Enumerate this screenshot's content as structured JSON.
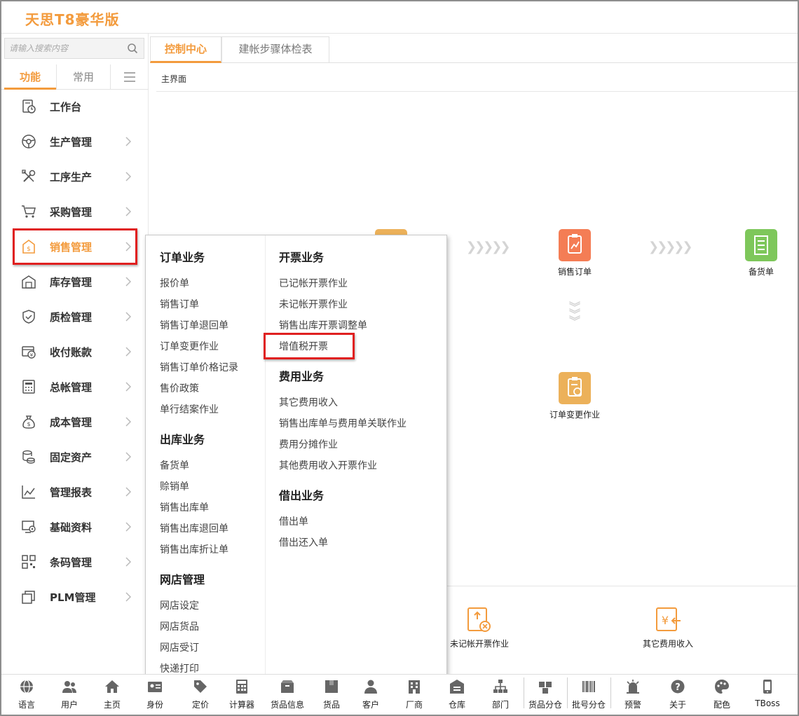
{
  "header": {
    "logo_text": "天思T8豪华版"
  },
  "search": {
    "placeholder": "请输入搜索内容"
  },
  "sidebar": {
    "tabs": [
      {
        "label": "功能"
      },
      {
        "label": "常用"
      }
    ],
    "items": [
      {
        "label": "工作台"
      },
      {
        "label": "生产管理"
      },
      {
        "label": "工序生产"
      },
      {
        "label": "采购管理"
      },
      {
        "label": "销售管理"
      },
      {
        "label": "库存管理"
      },
      {
        "label": "质检管理"
      },
      {
        "label": "收付账款"
      },
      {
        "label": "总帐管理"
      },
      {
        "label": "成本管理"
      },
      {
        "label": "固定资产"
      },
      {
        "label": "管理报表"
      },
      {
        "label": "基础资料"
      },
      {
        "label": "条码管理"
      },
      {
        "label": "PLM管理"
      }
    ]
  },
  "main_tabs": [
    {
      "label": "控制中心"
    },
    {
      "label": "建帐步骤体检表"
    }
  ],
  "breadcrumb": "主界面",
  "flow": {
    "nodes": [
      {
        "label": "销售订单",
        "color": "#f47d55"
      },
      {
        "label": "备货单",
        "color": "#7ec75b"
      },
      {
        "label": "订单变更作业",
        "color": "#ecb15a"
      }
    ],
    "lower_nodes": [
      {
        "label": "未记帐开票作业"
      },
      {
        "label": "其它费用收入"
      }
    ]
  },
  "popup": {
    "col1": [
      {
        "title": "订单业务",
        "items": [
          "报价单",
          "销售订单",
          "销售订单退回单",
          "订单变更作业",
          "销售订单价格记录",
          "售价政策",
          "单行结案作业"
        ]
      },
      {
        "title": "出库业务",
        "items": [
          "备货单",
          "赊销单",
          "销售出库单",
          "销售出库退回单",
          "销售出库折让单"
        ]
      },
      {
        "title": "网店管理",
        "items": [
          "网店设定",
          "网店货品",
          "网店受订",
          "快递打印"
        ]
      }
    ],
    "col2": [
      {
        "title": "开票业务",
        "items": [
          "已记帐开票作业",
          "未记帐开票作业",
          "销售出库开票调整单",
          "增值税开票"
        ]
      },
      {
        "title": "费用业务",
        "items": [
          "其它费用收入",
          "销售出库单与费用单关联作业",
          "费用分摊作业",
          "其他费用收入开票作业"
        ]
      },
      {
        "title": "借出业务",
        "items": [
          "借出单",
          "借出还入单"
        ]
      }
    ]
  },
  "bottom_bar": [
    {
      "label": "语言",
      "icon": "globe-icon"
    },
    {
      "label": "用户",
      "icon": "users-icon"
    },
    {
      "label": "主页",
      "icon": "home-icon"
    },
    {
      "label": "身份",
      "icon": "id-card-icon"
    },
    {
      "label": "定价",
      "icon": "price-tag-icon"
    },
    {
      "label": "计算器",
      "icon": "calculator-icon"
    },
    {
      "label": "货品信息",
      "icon": "box-info-icon"
    },
    {
      "label": "货品",
      "icon": "box-icon"
    },
    {
      "label": "客户",
      "icon": "customer-icon"
    },
    {
      "label": "厂商",
      "icon": "building-icon"
    },
    {
      "label": "仓库",
      "icon": "warehouse-icon"
    },
    {
      "label": "部门",
      "icon": "org-chart-icon"
    },
    {
      "label": "货品分仓",
      "icon": "stock-split-icon"
    },
    {
      "label": "批号分仓",
      "icon": "barcode-icon"
    },
    {
      "label": "预警",
      "icon": "alarm-icon"
    },
    {
      "label": "关于",
      "icon": "help-icon"
    },
    {
      "label": "配色",
      "icon": "palette-icon"
    },
    {
      "label": "TBoss",
      "icon": "phone-icon"
    }
  ],
  "colors": {
    "accent": "#f39b3d",
    "highlight": "#e02020"
  }
}
